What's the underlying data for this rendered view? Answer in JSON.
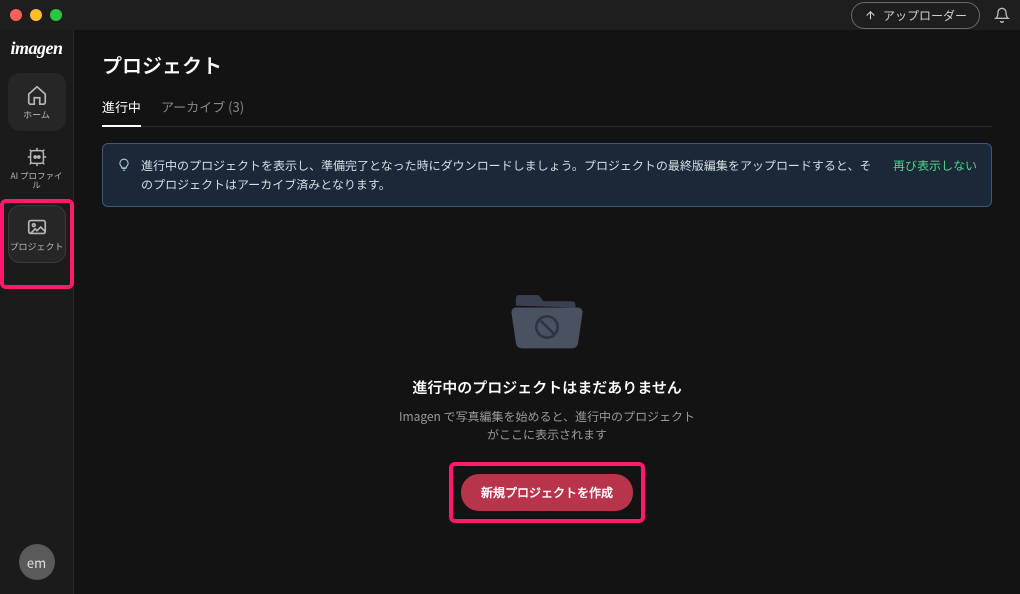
{
  "titlebar": {
    "uploader_label": "アップローダー"
  },
  "sidebar": {
    "logo": "imagen",
    "items": [
      {
        "label": "ホーム"
      },
      {
        "label": "AI プロファイル"
      },
      {
        "label": "プロジェクト"
      }
    ],
    "avatar_initials": "em"
  },
  "page": {
    "title": "プロジェクト"
  },
  "tabs": {
    "in_progress": "進行中",
    "archive": "アーカイブ (3)"
  },
  "banner": {
    "message": "進行中のプロジェクトを表示し、準備完了となった時にダウンロードしましょう。プロジェクトの最終版編集をアップロードすると、そのプロジェクトはアーカイブ済みとなります。",
    "dismiss": "再び表示しない"
  },
  "empty": {
    "title": "進行中のプロジェクトはまだありません",
    "desc": "Imagen で写真編集を始めると、進行中のプロジェクトがここに表示されます",
    "cta": "新規プロジェクトを作成"
  }
}
